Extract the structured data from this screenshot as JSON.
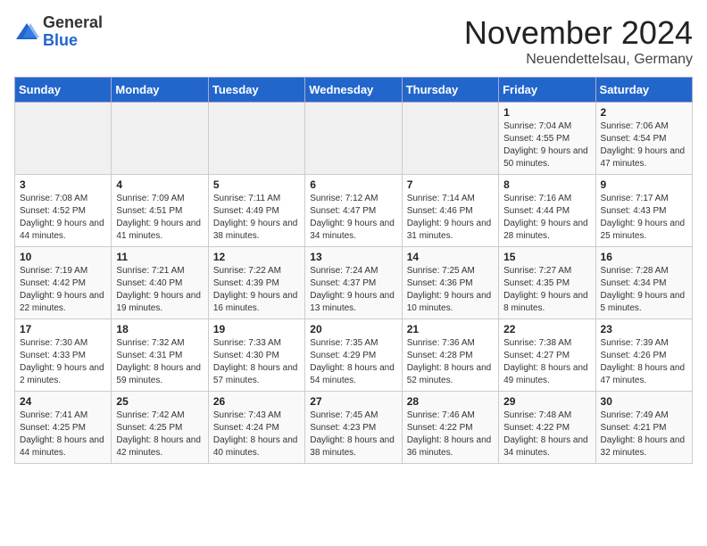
{
  "logo": {
    "general": "General",
    "blue": "Blue"
  },
  "header": {
    "month": "November 2024",
    "location": "Neuendettelsau, Germany"
  },
  "weekdays": [
    "Sunday",
    "Monday",
    "Tuesday",
    "Wednesday",
    "Thursday",
    "Friday",
    "Saturday"
  ],
  "rows": [
    [
      {
        "day": "",
        "detail": ""
      },
      {
        "day": "",
        "detail": ""
      },
      {
        "day": "",
        "detail": ""
      },
      {
        "day": "",
        "detail": ""
      },
      {
        "day": "",
        "detail": ""
      },
      {
        "day": "1",
        "detail": "Sunrise: 7:04 AM\nSunset: 4:55 PM\nDaylight: 9 hours and 50 minutes."
      },
      {
        "day": "2",
        "detail": "Sunrise: 7:06 AM\nSunset: 4:54 PM\nDaylight: 9 hours and 47 minutes."
      }
    ],
    [
      {
        "day": "3",
        "detail": "Sunrise: 7:08 AM\nSunset: 4:52 PM\nDaylight: 9 hours and 44 minutes."
      },
      {
        "day": "4",
        "detail": "Sunrise: 7:09 AM\nSunset: 4:51 PM\nDaylight: 9 hours and 41 minutes."
      },
      {
        "day": "5",
        "detail": "Sunrise: 7:11 AM\nSunset: 4:49 PM\nDaylight: 9 hours and 38 minutes."
      },
      {
        "day": "6",
        "detail": "Sunrise: 7:12 AM\nSunset: 4:47 PM\nDaylight: 9 hours and 34 minutes."
      },
      {
        "day": "7",
        "detail": "Sunrise: 7:14 AM\nSunset: 4:46 PM\nDaylight: 9 hours and 31 minutes."
      },
      {
        "day": "8",
        "detail": "Sunrise: 7:16 AM\nSunset: 4:44 PM\nDaylight: 9 hours and 28 minutes."
      },
      {
        "day": "9",
        "detail": "Sunrise: 7:17 AM\nSunset: 4:43 PM\nDaylight: 9 hours and 25 minutes."
      }
    ],
    [
      {
        "day": "10",
        "detail": "Sunrise: 7:19 AM\nSunset: 4:42 PM\nDaylight: 9 hours and 22 minutes."
      },
      {
        "day": "11",
        "detail": "Sunrise: 7:21 AM\nSunset: 4:40 PM\nDaylight: 9 hours and 19 minutes."
      },
      {
        "day": "12",
        "detail": "Sunrise: 7:22 AM\nSunset: 4:39 PM\nDaylight: 9 hours and 16 minutes."
      },
      {
        "day": "13",
        "detail": "Sunrise: 7:24 AM\nSunset: 4:37 PM\nDaylight: 9 hours and 13 minutes."
      },
      {
        "day": "14",
        "detail": "Sunrise: 7:25 AM\nSunset: 4:36 PM\nDaylight: 9 hours and 10 minutes."
      },
      {
        "day": "15",
        "detail": "Sunrise: 7:27 AM\nSunset: 4:35 PM\nDaylight: 9 hours and 8 minutes."
      },
      {
        "day": "16",
        "detail": "Sunrise: 7:28 AM\nSunset: 4:34 PM\nDaylight: 9 hours and 5 minutes."
      }
    ],
    [
      {
        "day": "17",
        "detail": "Sunrise: 7:30 AM\nSunset: 4:33 PM\nDaylight: 9 hours and 2 minutes."
      },
      {
        "day": "18",
        "detail": "Sunrise: 7:32 AM\nSunset: 4:31 PM\nDaylight: 8 hours and 59 minutes."
      },
      {
        "day": "19",
        "detail": "Sunrise: 7:33 AM\nSunset: 4:30 PM\nDaylight: 8 hours and 57 minutes."
      },
      {
        "day": "20",
        "detail": "Sunrise: 7:35 AM\nSunset: 4:29 PM\nDaylight: 8 hours and 54 minutes."
      },
      {
        "day": "21",
        "detail": "Sunrise: 7:36 AM\nSunset: 4:28 PM\nDaylight: 8 hours and 52 minutes."
      },
      {
        "day": "22",
        "detail": "Sunrise: 7:38 AM\nSunset: 4:27 PM\nDaylight: 8 hours and 49 minutes."
      },
      {
        "day": "23",
        "detail": "Sunrise: 7:39 AM\nSunset: 4:26 PM\nDaylight: 8 hours and 47 minutes."
      }
    ],
    [
      {
        "day": "24",
        "detail": "Sunrise: 7:41 AM\nSunset: 4:25 PM\nDaylight: 8 hours and 44 minutes."
      },
      {
        "day": "25",
        "detail": "Sunrise: 7:42 AM\nSunset: 4:25 PM\nDaylight: 8 hours and 42 minutes."
      },
      {
        "day": "26",
        "detail": "Sunrise: 7:43 AM\nSunset: 4:24 PM\nDaylight: 8 hours and 40 minutes."
      },
      {
        "day": "27",
        "detail": "Sunrise: 7:45 AM\nSunset: 4:23 PM\nDaylight: 8 hours and 38 minutes."
      },
      {
        "day": "28",
        "detail": "Sunrise: 7:46 AM\nSunset: 4:22 PM\nDaylight: 8 hours and 36 minutes."
      },
      {
        "day": "29",
        "detail": "Sunrise: 7:48 AM\nSunset: 4:22 PM\nDaylight: 8 hours and 34 minutes."
      },
      {
        "day": "30",
        "detail": "Sunrise: 7:49 AM\nSunset: 4:21 PM\nDaylight: 8 hours and 32 minutes."
      }
    ]
  ]
}
